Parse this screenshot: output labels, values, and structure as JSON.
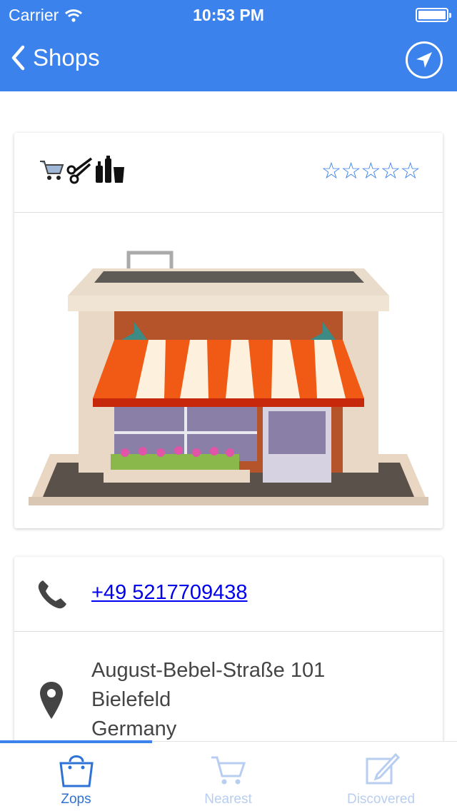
{
  "status_bar": {
    "carrier": "Carrier",
    "time": "10:53 PM"
  },
  "nav": {
    "back_label": "Shops",
    "location_icon": "location-arrow-icon"
  },
  "shop": {
    "category_icons": [
      "cart-icon",
      "scissors-icon",
      "bottles-icon"
    ],
    "rating": "☆☆☆☆☆",
    "rating_value": 0,
    "rating_max": 5,
    "image": "storefront-illustration"
  },
  "contact": {
    "phone": "+49 5217709438",
    "address_line1": "August-Bebel-Straße 101",
    "address_line2": "Bielefeld",
    "address_line3": "Germany"
  },
  "tabs": [
    {
      "label": "Zops",
      "icon": "shopping-bag-icon",
      "active": true
    },
    {
      "label": "Nearest",
      "icon": "cart-icon",
      "active": false
    },
    {
      "label": "Discovered",
      "icon": "edit-icon",
      "active": false
    }
  ],
  "colors": {
    "accent": "#3b82ec",
    "tab_inactive": "#b8cef0",
    "link": "#0000ee"
  }
}
